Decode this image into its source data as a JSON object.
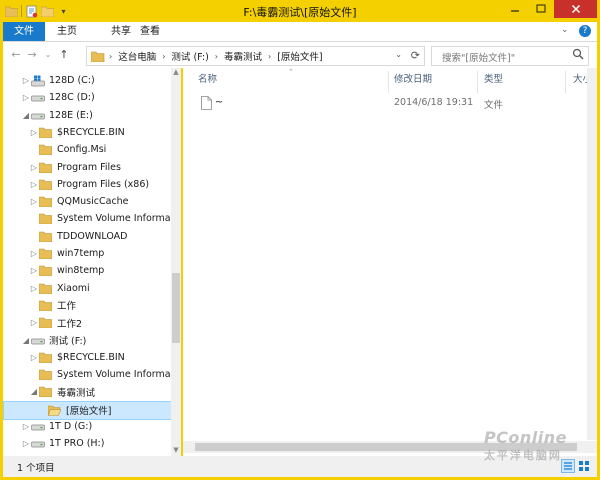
{
  "window": {
    "title": "F:\\毒霸测试\\[原始文件]"
  },
  "ribbon": {
    "tabs": [
      "文件",
      "主页",
      "共享",
      "查看"
    ]
  },
  "address": {
    "segments": [
      "这台电脑",
      "测试 (F:)",
      "毒霸测试",
      "[原始文件]"
    ]
  },
  "search": {
    "placeholder": "搜索\"[原始文件]\""
  },
  "nav_tree": [
    {
      "label": "128D (C:)",
      "type": "drive-win",
      "level": 1,
      "expand": "▷"
    },
    {
      "label": "128C (D:)",
      "type": "drive",
      "level": 1,
      "expand": "▷"
    },
    {
      "label": "128E (E:)",
      "type": "drive",
      "level": 1,
      "expand": "◢"
    },
    {
      "label": "$RECYCLE.BIN",
      "type": "folder",
      "level": 2,
      "expand": "▷"
    },
    {
      "label": "Config.Msi",
      "type": "folder",
      "level": 2,
      "expand": ""
    },
    {
      "label": "Program Files",
      "type": "folder",
      "level": 2,
      "expand": "▷"
    },
    {
      "label": "Program Files (x86)",
      "type": "folder",
      "level": 2,
      "expand": "▷"
    },
    {
      "label": "QQMusicCache",
      "type": "folder",
      "level": 2,
      "expand": "▷"
    },
    {
      "label": "System Volume Informati",
      "type": "folder",
      "level": 2,
      "expand": ""
    },
    {
      "label": "TDDOWNLOAD",
      "type": "folder",
      "level": 2,
      "expand": ""
    },
    {
      "label": "win7temp",
      "type": "folder",
      "level": 2,
      "expand": "▷"
    },
    {
      "label": "win8temp",
      "type": "folder",
      "level": 2,
      "expand": "▷"
    },
    {
      "label": "Xiaomi",
      "type": "folder",
      "level": 2,
      "expand": "▷"
    },
    {
      "label": "工作",
      "type": "folder",
      "level": 2,
      "expand": ""
    },
    {
      "label": "工作2",
      "type": "folder",
      "level": 2,
      "expand": "▷"
    },
    {
      "label": "测试 (F:)",
      "type": "drive",
      "level": 1,
      "expand": "◢"
    },
    {
      "label": "$RECYCLE.BIN",
      "type": "folder",
      "level": 2,
      "expand": "▷"
    },
    {
      "label": "System Volume Informati",
      "type": "folder",
      "level": 2,
      "expand": ""
    },
    {
      "label": "毒霸测试",
      "type": "folder",
      "level": 2,
      "expand": "◢"
    },
    {
      "label": "[原始文件]",
      "type": "folder-open",
      "level": 3,
      "expand": "",
      "selected": true
    },
    {
      "label": "1T D (G:)",
      "type": "drive",
      "level": 1,
      "expand": "▷"
    },
    {
      "label": "1T PRO (H:)",
      "type": "drive",
      "level": 1,
      "expand": "▷"
    }
  ],
  "columns": [
    "名称",
    "修改日期",
    "类型",
    "大小"
  ],
  "files": [
    {
      "name": "~",
      "modified": "2014/6/18 19:31",
      "type": "文件",
      "size": ""
    }
  ],
  "status": {
    "count": "1 个项目"
  },
  "watermark": {
    "brand": "PConline",
    "sub": "太平洋电脑网"
  },
  "colors": {
    "titlebar": "#f4d000",
    "accent": "#1979ca",
    "close": "#c7302b",
    "selection": "#cce8ff",
    "folder": "#e8bd55"
  }
}
